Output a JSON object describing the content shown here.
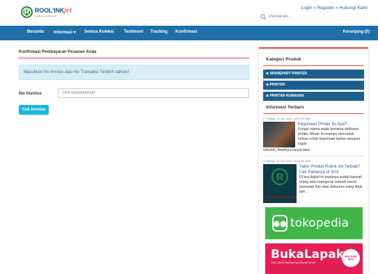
{
  "brand": {
    "name": "ROOL'INK",
    "suffix": "jet",
    "tagline": "Leading in printing tech"
  },
  "top_links": {
    "login": "Login",
    "register": "Register",
    "contact": "Hubungi Kami",
    "sep": " » "
  },
  "search": {
    "placeholder": "Pencarian..."
  },
  "nav": {
    "items": [
      "Beranda",
      "Informasi ▾",
      "Semua Koleksi",
      "Testimoni",
      "Tracking",
      "Konfirmasi"
    ],
    "cart": "Keranjang (0)"
  },
  "main": {
    "title": "Konfirmasi Pembayaran Pesanan Anda",
    "alert": "Masukkan No Invoice atau No Transaksi Terlebih dahulu!",
    "invoice_label": "No Invoice",
    "invoice_placeholder": "TRX-0000000000",
    "submit_label": "Cek Invoice"
  },
  "sidebar": {
    "categories_title": "Kategori Produk",
    "categories": [
      "⊕ SPAREPART PRINTER",
      "⊕ PRINTER",
      "⊕ PRINTER RUMAHAN"
    ],
    "info_title": "Informasi Terbaru",
    "articles": [
      {
        "date": "Selasa, 21 Jun 2022, 14:09:32 WIB",
        "title": "Kegunaan Printer Itu Apa?",
        "desc": "Fungsi utama sejak pertama dirilisnya printer. Mesin ini mampu mencetak tulisan untuk keperluan kantor ataupun tugas",
        "tail": "sekolah. Awalnya hanya bisa..."
      },
      {
        "date": "Selasa, 21 Jun 2022, 14:14:34 WIB",
        "title": "Yakin Produk Rolink Jet Terbaik? Cek Faktanya di Sini!",
        "desc": "Di era digital ini pastinya sudah banyak orang tahu mengenai sebuah mesin pencetak foto atau dokumen yang tidak lain ..."
      }
    ],
    "tokopedia": "tokopedia",
    "bukalapak": "BukaLapak",
    "bukalapak_tagline": "THE GREAT INDONESIA ONLINE SHOP",
    "bukalapak_badge": "MAU BISA BISA"
  }
}
